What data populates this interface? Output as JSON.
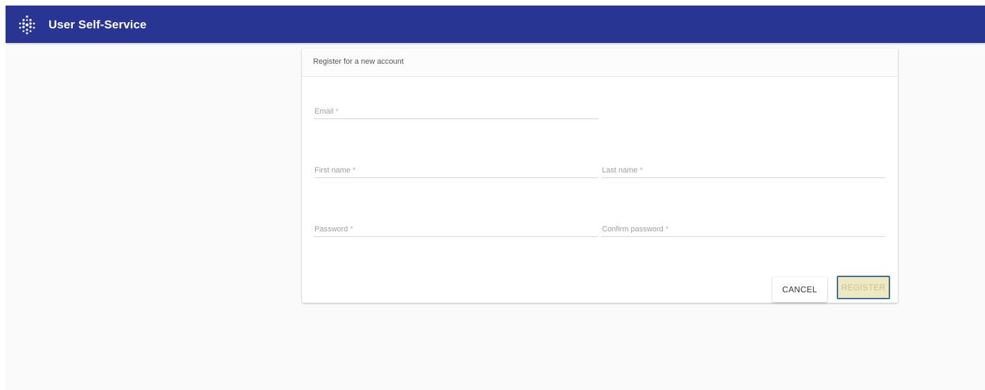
{
  "app": {
    "title": "User Self-Service",
    "logo_icon": "dots-diamond-logo-icon"
  },
  "form": {
    "title": "Register for a new account",
    "fields": {
      "email": {
        "label": "Email",
        "value": ""
      },
      "first_name": {
        "label": "First name",
        "value": ""
      },
      "last_name": {
        "label": "Last name",
        "value": ""
      },
      "password": {
        "label": "Password",
        "value": ""
      },
      "confirm_password": {
        "label": "Confirm password",
        "value": ""
      }
    },
    "required_marker": "*",
    "buttons": {
      "cancel": "CANCEL",
      "register": "REGISTER"
    }
  },
  "colors": {
    "header_bg": "#283593",
    "register_bg": "#ede9c2",
    "register_text": "#c9c38e",
    "focus_border": "#3f6a9a"
  }
}
